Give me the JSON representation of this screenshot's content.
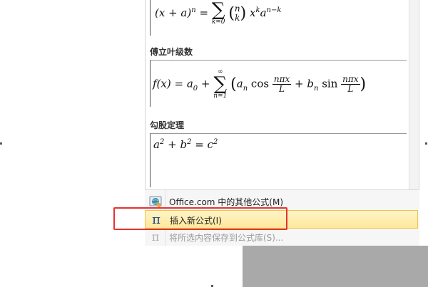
{
  "gallery": {
    "binomial": {
      "lhs": "(x + a)",
      "lhs_exp": "n",
      "eq": "=",
      "sum_symbol": "∑",
      "sum_lower": "k=0",
      "binom_top": "n",
      "binom_bottom": "k",
      "term": "x",
      "term_exp": "k",
      "term2": "a",
      "term2_exp": "n−k"
    },
    "fourier": {
      "title": "傅立叶级数",
      "lhs": "f(x) = a",
      "a_sub": "0",
      "plus": "+",
      "sum_symbol": "∑",
      "sum_upper": "∞",
      "sum_lower": "n=1",
      "an": "a",
      "an_sub": "n",
      "cos": "cos",
      "frac_num": "nπx",
      "frac_den": "L",
      "plus2": "+ b",
      "bn_sub": "n",
      "sin": "sin"
    },
    "pythagoras": {
      "title": "勾股定理",
      "a": "a",
      "a_exp": "2",
      "plus": "+ b",
      "b_exp": "2",
      "eq": "= c",
      "c_exp": "2"
    }
  },
  "menu": {
    "items": [
      {
        "label": "Office.com 中的其他公式(M)",
        "icon": "office-globe-icon",
        "state": "normal"
      },
      {
        "label": "插入新公式(I)",
        "icon": "pi-icon",
        "state": "highlighted"
      },
      {
        "label": "将所选内容保存到公式库(S)...",
        "icon": "save-equation-icon",
        "state": "disabled"
      }
    ]
  },
  "colors": {
    "highlight": "#ffe89a",
    "annotation": "#e33333"
  }
}
